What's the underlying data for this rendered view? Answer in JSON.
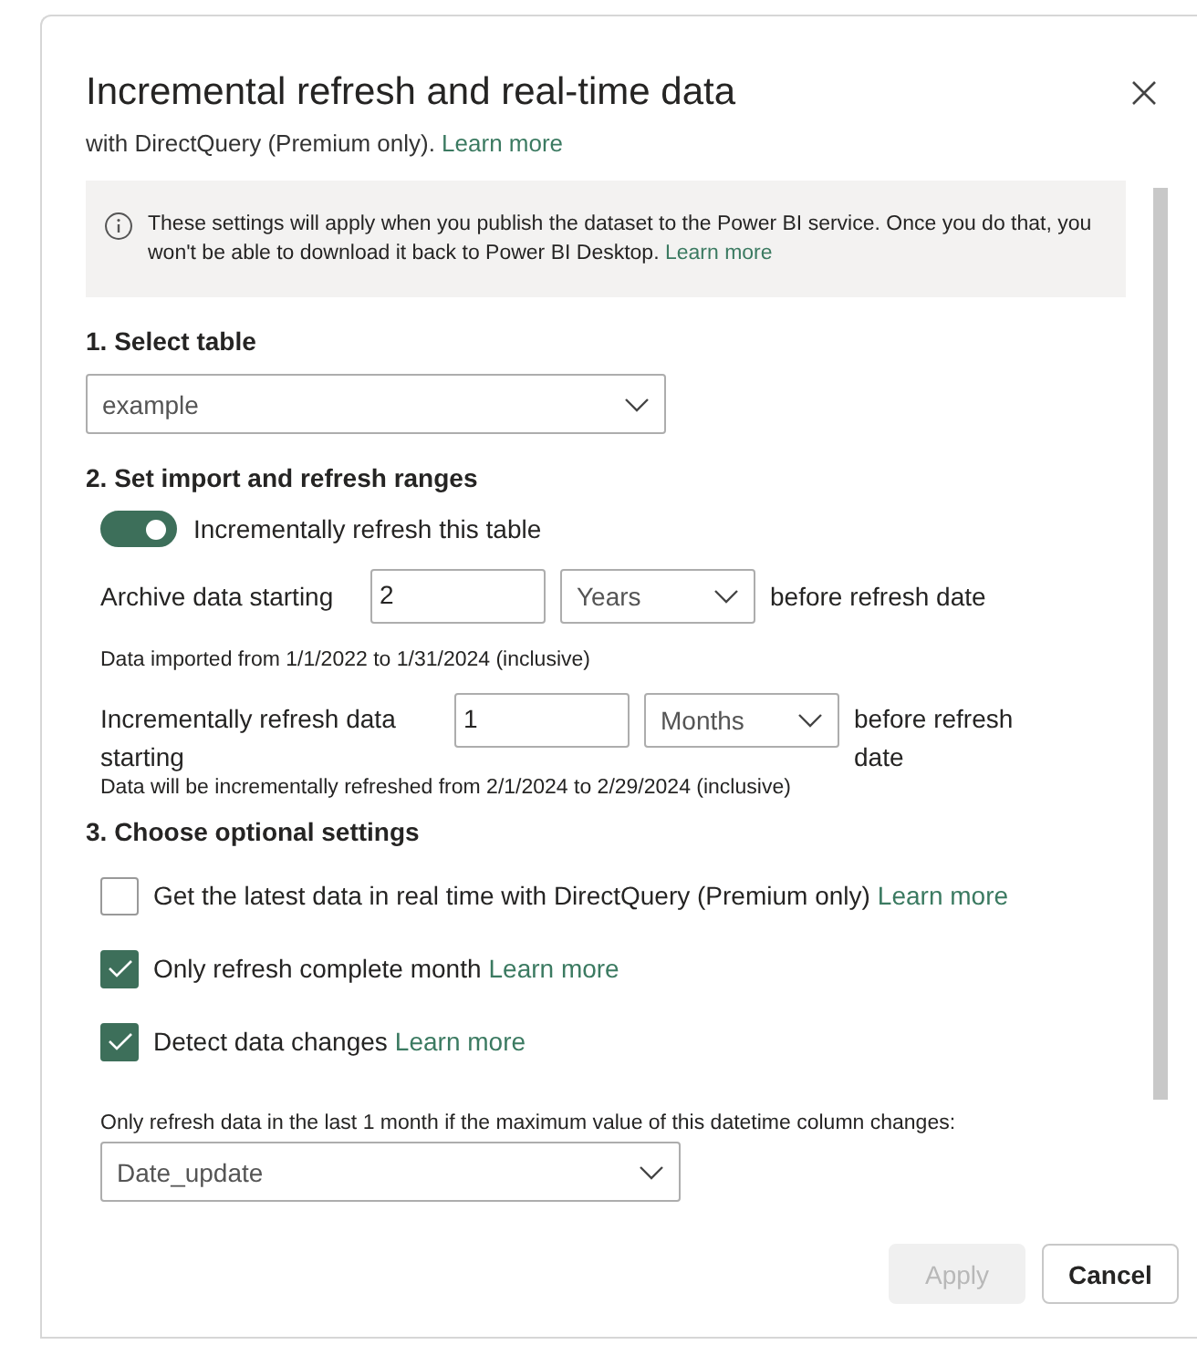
{
  "dialog": {
    "title": "Incremental refresh and real-time data"
  },
  "intro": {
    "text": "with DirectQuery (Premium only).",
    "link": "Learn more"
  },
  "notice": {
    "text": "These settings will apply when you publish the dataset to the Power BI service. Once you do that, you won't be able to download it back to Power BI Desktop.",
    "link": "Learn more"
  },
  "select_table": {
    "heading": "1. Select table",
    "value": "example"
  },
  "ranges": {
    "heading": "2. Set import and refresh ranges",
    "toggle": {
      "label": "Incrementally refresh this table",
      "on": true
    },
    "archive": {
      "label": "Archive data starting",
      "value": "2",
      "unit": "Years",
      "suffix": "before refresh date",
      "note": "Data imported from 1/1/2022 to 1/31/2024 (inclusive)"
    },
    "refresh": {
      "label": "Incrementally refresh data starting",
      "value": "1",
      "unit": "Months",
      "suffix": "before refresh date",
      "note": "Data will be incrementally refreshed from 2/1/2024 to 2/29/2024 (inclusive)"
    }
  },
  "optional": {
    "heading": "3. Choose optional settings",
    "options": [
      {
        "label": "Get the latest data in real time with DirectQuery (Premium only)",
        "link": "Learn more",
        "checked": false
      },
      {
        "label": "Only refresh complete month",
        "link": "Learn more",
        "checked": true
      },
      {
        "label": "Detect data changes",
        "link": "Learn more",
        "checked": true
      }
    ],
    "column_label": "Only refresh data in the last 1 month if the maximum value of this datetime column changes:",
    "column_value": "Date_update"
  },
  "buttons": [
    {
      "label": "Apply",
      "disabled": true
    },
    {
      "label": "Cancel",
      "disabled": false
    }
  ]
}
